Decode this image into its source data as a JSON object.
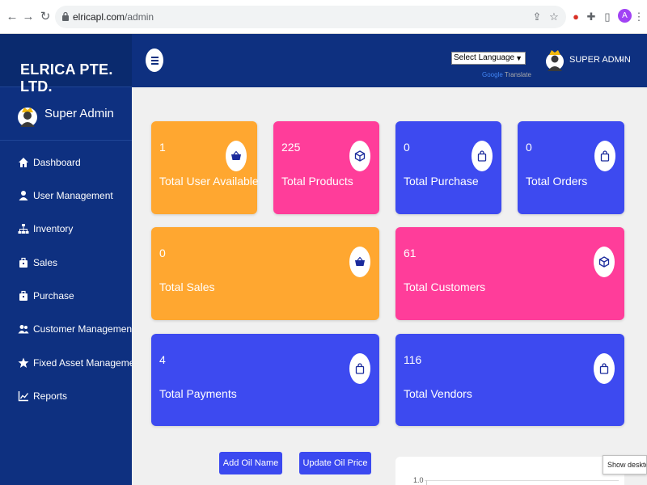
{
  "browser": {
    "url_host": "elricapl.com",
    "url_path": "/admin",
    "profile_initial": "A"
  },
  "sidebar": {
    "brand": "ELRICA PTE. LTD.",
    "user_name": "Super Admin",
    "items": [
      {
        "label": "Dashboard",
        "icon": "home-icon"
      },
      {
        "label": "User Management",
        "icon": "user-icon"
      },
      {
        "label": "Inventory",
        "icon": "sitemap-icon"
      },
      {
        "label": "Sales",
        "icon": "briefcase-icon"
      },
      {
        "label": "Purchase",
        "icon": "briefcase-icon"
      },
      {
        "label": "Customer Management",
        "icon": "users-icon"
      },
      {
        "label": "Fixed Asset Management",
        "icon": "star-icon"
      },
      {
        "label": "Reports",
        "icon": "chart-line-icon"
      }
    ]
  },
  "header": {
    "language_select": "Select Language",
    "translate_brand": "Google",
    "translate_label": "Translate",
    "admin_name": "SUPER ADMIN"
  },
  "cards": [
    {
      "value": "1",
      "label": "Total User Available",
      "color": "#ffa730",
      "icon": "basket-icon"
    },
    {
      "value": "225",
      "label": "Total Products",
      "color": "#ff3d9a",
      "icon": "cube-icon"
    },
    {
      "value": "0",
      "label": "Total Purchase",
      "color": "#3d4af0",
      "icon": "shopping-bag-icon"
    },
    {
      "value": "0",
      "label": "Total Orders",
      "color": "#3d4af0",
      "icon": "shopping-bag-icon"
    },
    {
      "value": "0",
      "label": "Total Sales",
      "color": "#ffa730",
      "icon": "basket-icon"
    },
    {
      "value": "61",
      "label": "Total Customers",
      "color": "#ff3d9a",
      "icon": "cube-icon"
    },
    {
      "value": "4",
      "label": "Total Payments",
      "color": "#3d4af0",
      "icon": "shopping-bag-icon"
    },
    {
      "value": "116",
      "label": "Total Vendors",
      "color": "#3d4af0",
      "icon": "shopping-bag-icon"
    }
  ],
  "actions": {
    "add_oil_name": "Add Oil Name",
    "update_oil_price": "Update Oil Price"
  },
  "chart": {
    "top_tick": "1.0"
  },
  "tooltip": "Show desktop"
}
